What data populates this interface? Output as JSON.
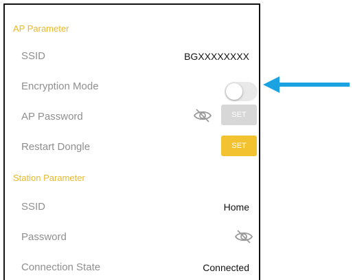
{
  "ap_section": {
    "header": "AP Parameter",
    "ssid_label": "SSID",
    "ssid_value": "BGXXXXXXXX",
    "encryption_label": "Encryption Mode",
    "encryption_enabled": false,
    "password_label": "AP Password",
    "password_set_label": "SET",
    "restart_label": "Restart Dongle",
    "restart_set_label": "SET"
  },
  "station_section": {
    "header": "Station Parameter",
    "ssid_label": "SSID",
    "ssid_value": "Home",
    "password_label": "Password",
    "connection_label": "Connection State",
    "connection_value": "Connected"
  },
  "colors": {
    "accent": "#f2c230",
    "section_header": "#e9b92a",
    "label": "#8f8f8f",
    "disabled_button": "#d7d7d7",
    "arrow": "#1aa3e0"
  },
  "icons": {
    "password_visibility": "eye-slash-icon",
    "annotation_arrow": "arrow-left-icon"
  }
}
